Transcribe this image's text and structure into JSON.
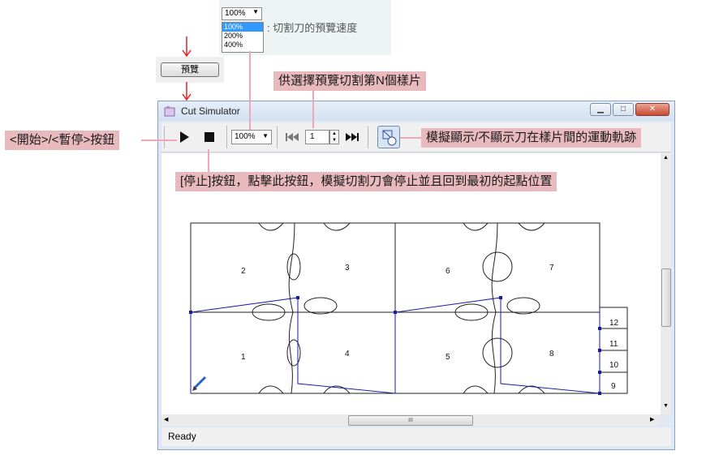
{
  "speed_panel": {
    "selected": "100%",
    "options": [
      "100%",
      "200%",
      "400%"
    ],
    "caption": ": 切割刀的預覽速度"
  },
  "preview_button": {
    "label": "預覽"
  },
  "callouts": {
    "select_sample": "供選擇預覽切割第N個樣片",
    "start_pause": "<開始>/<暫停>按鈕",
    "toggle_path": "模擬顯示/不顯示刀在樣片間的運動軌跡",
    "stop": "[停止]按鈕，點擊此按鈕，模擬切割刀會停止並且回到最初的起點位置"
  },
  "window": {
    "title": "Cut Simulator",
    "toolbar": {
      "play_icon": "play-icon",
      "stop_icon": "stop-icon",
      "speed_value": "100%",
      "first_icon": "skip-first-icon",
      "sample_number": "1",
      "last_icon": "skip-last-icon",
      "path_toggle_icon": "path-toggle-icon"
    },
    "status": "Ready",
    "hscroll_grip": "III"
  },
  "drawing": {
    "piece_labels": [
      "1",
      "2",
      "3",
      "4",
      "5",
      "6",
      "7",
      "8",
      "9",
      "10",
      "11",
      "12"
    ]
  },
  "colors": {
    "callout_bg": "#e8b9bd",
    "callout_line": "#f0a6b6",
    "arrow_red": "#e02020",
    "trace_blue": "#1a1aa8"
  }
}
